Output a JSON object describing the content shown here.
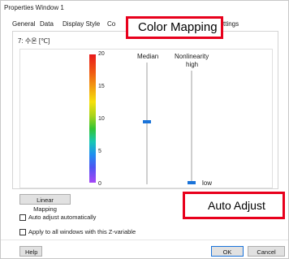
{
  "window": {
    "title": "Properties Window 1"
  },
  "tabs": [
    "General",
    "Data",
    "Display Style",
    "Co",
    "ttings"
  ],
  "callouts": {
    "tab_overlay": "Color Mapping",
    "button_overlay": "Auto Adjust"
  },
  "panel": {
    "variable_label": "7: 수온 [℃]",
    "colorbar_ticks": [
      "20",
      "15",
      "10",
      "5",
      "0"
    ],
    "colorbar_range": [
      0,
      20
    ],
    "median_label": "Median",
    "nonlinearity_label": "Nonlinearity",
    "nonlinearity_high": "high",
    "nonlinearity_low": "low",
    "median_value": 9.5,
    "nonlinearity_level": "low"
  },
  "buttons": {
    "linear_mapping": "Linear Mapping",
    "help": "Help",
    "ok": "OK",
    "cancel": "Cancel"
  },
  "checkboxes": {
    "auto_adjust": {
      "label": "Auto adjust automatically",
      "checked": false
    },
    "apply_all": {
      "label": "Apply to all windows with this Z-variable",
      "checked": false
    }
  },
  "colors": {
    "accent": "#1a73d9",
    "callout_border": "#e8001c"
  }
}
